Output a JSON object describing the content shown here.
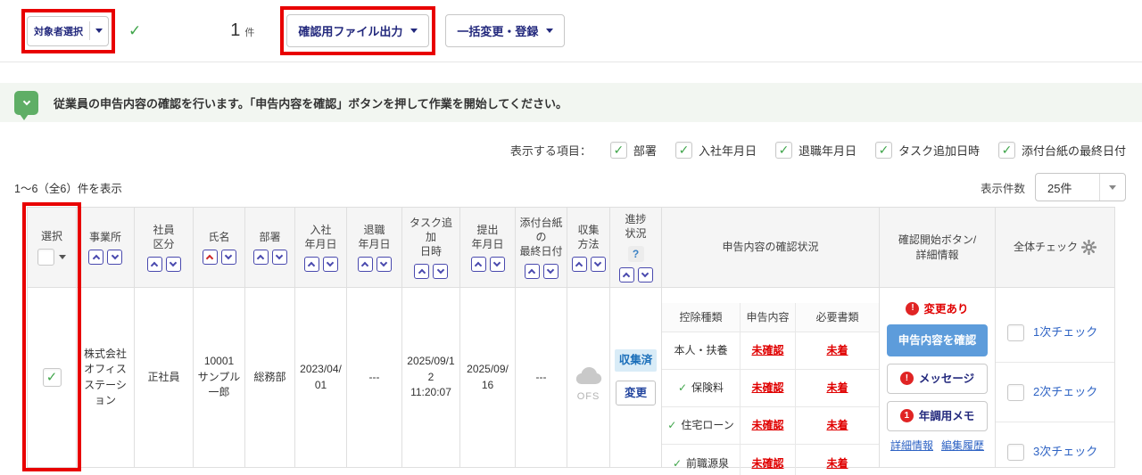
{
  "toolbar": {
    "target_select": {
      "label": "対象者選択"
    },
    "selected_count": {
      "value": "1",
      "unit": "件"
    },
    "file_output": {
      "label": "確認用ファイル出力"
    },
    "bulk_change": {
      "label": "一括変更・登録"
    }
  },
  "notice": {
    "text": "従業員の申告内容の確認を行います。「申告内容を確認」ボタンを押して作業を開始してください。"
  },
  "display_options": {
    "label": "表示する項目：",
    "items": [
      {
        "label": "部署",
        "checked": true
      },
      {
        "label": "入社年月日",
        "checked": true
      },
      {
        "label": "退職年月日",
        "checked": true
      },
      {
        "label": "タスク追加日時",
        "checked": true
      },
      {
        "label": "添付台紙の最終日付",
        "checked": true
      }
    ]
  },
  "pagination": {
    "range_text": "1〜6（全6）件を表示",
    "per_page_label": "表示件数",
    "per_page_value": "25件"
  },
  "table": {
    "columns": [
      {
        "key": "select",
        "label": "選択"
      },
      {
        "key": "office",
        "label": "事業所",
        "sort": true
      },
      {
        "key": "employee_type",
        "label": "社員\n区分",
        "sort": true
      },
      {
        "key": "name",
        "label": "氏名",
        "sort": true,
        "sort_active": "asc"
      },
      {
        "key": "department",
        "label": "部署",
        "sort": true
      },
      {
        "key": "hire_date",
        "label": "入社\n年月日",
        "sort": true
      },
      {
        "key": "retire_date",
        "label": "退職\n年月日",
        "sort": true
      },
      {
        "key": "task_added",
        "label": "タスク追\n加\n日時",
        "sort": true
      },
      {
        "key": "submit_date",
        "label": "提出\n年月日",
        "sort": true
      },
      {
        "key": "attachment_last_date",
        "label": "添付台紙\nの\n最終日付",
        "sort": true
      },
      {
        "key": "collect_method",
        "label": "収集\n方法",
        "sort": true
      },
      {
        "key": "progress",
        "label": "進捗\n状況",
        "sort": true,
        "help": true
      },
      {
        "key": "declaration_status",
        "label": "申告内容の確認状況"
      },
      {
        "key": "confirm_start",
        "label": "確認開始ボタン/\n詳細情報"
      },
      {
        "key": "overall_check",
        "label": "全体チェック"
      }
    ],
    "row": {
      "selected": true,
      "office": "株式会社オフィスステーション",
      "employee_type": "正社員",
      "employee_code": "10001",
      "employee_name": "サンプル一郎",
      "department": "総務部",
      "hire_date": "2023/04/01",
      "retire_date": "---",
      "task_added": "2025/09/12\n11:20:07",
      "submit_date": "2025/09/16",
      "attachment_last_date": "---",
      "collect_method": "OFS",
      "progress": {
        "status": "収集済",
        "change_label": "変更"
      },
      "declaration": {
        "headers": [
          "控除種類",
          "申告内容",
          "必要書類"
        ],
        "rows": [
          {
            "checked": false,
            "type": "本人・扶養",
            "content": "未確認",
            "documents": "未着"
          },
          {
            "checked": true,
            "type": "保険料",
            "content": "未確認",
            "documents": "未着"
          },
          {
            "checked": true,
            "type": "住宅ローン",
            "content": "未確認",
            "documents": "未着"
          },
          {
            "checked": true,
            "type": "前職源泉",
            "content": "未確認",
            "documents": "未着"
          }
        ]
      },
      "actions": {
        "change_alert": "変更あり",
        "confirm_button": "申告内容を確認",
        "message_button": "メッセージ",
        "memo_button": "年調用メモ",
        "memo_count": "1",
        "detail_link": "詳細情報",
        "history_link": "編集履歴"
      },
      "overall_checks": [
        {
          "label": "1次チェック",
          "checked": false
        },
        {
          "label": "2次チェック",
          "checked": false
        },
        {
          "label": "3次チェック",
          "checked": false
        }
      ]
    }
  },
  "icons": {
    "check_glyph": "✓",
    "help_glyph": "?",
    "alert_glyph": "!"
  },
  "colors": {
    "annotation_red": "#e80000",
    "primary_navy": "#23297d",
    "link_blue": "#2e63c4",
    "alert_red": "#e00000",
    "success_green": "#3fa54a",
    "collected_chip_bg": "#d9ecf7",
    "collected_chip_text": "#1b6fba",
    "confirm_button_bg": "#5d9cdb",
    "header_bg": "#f5f5f5",
    "notice_green": "#5fae66"
  }
}
